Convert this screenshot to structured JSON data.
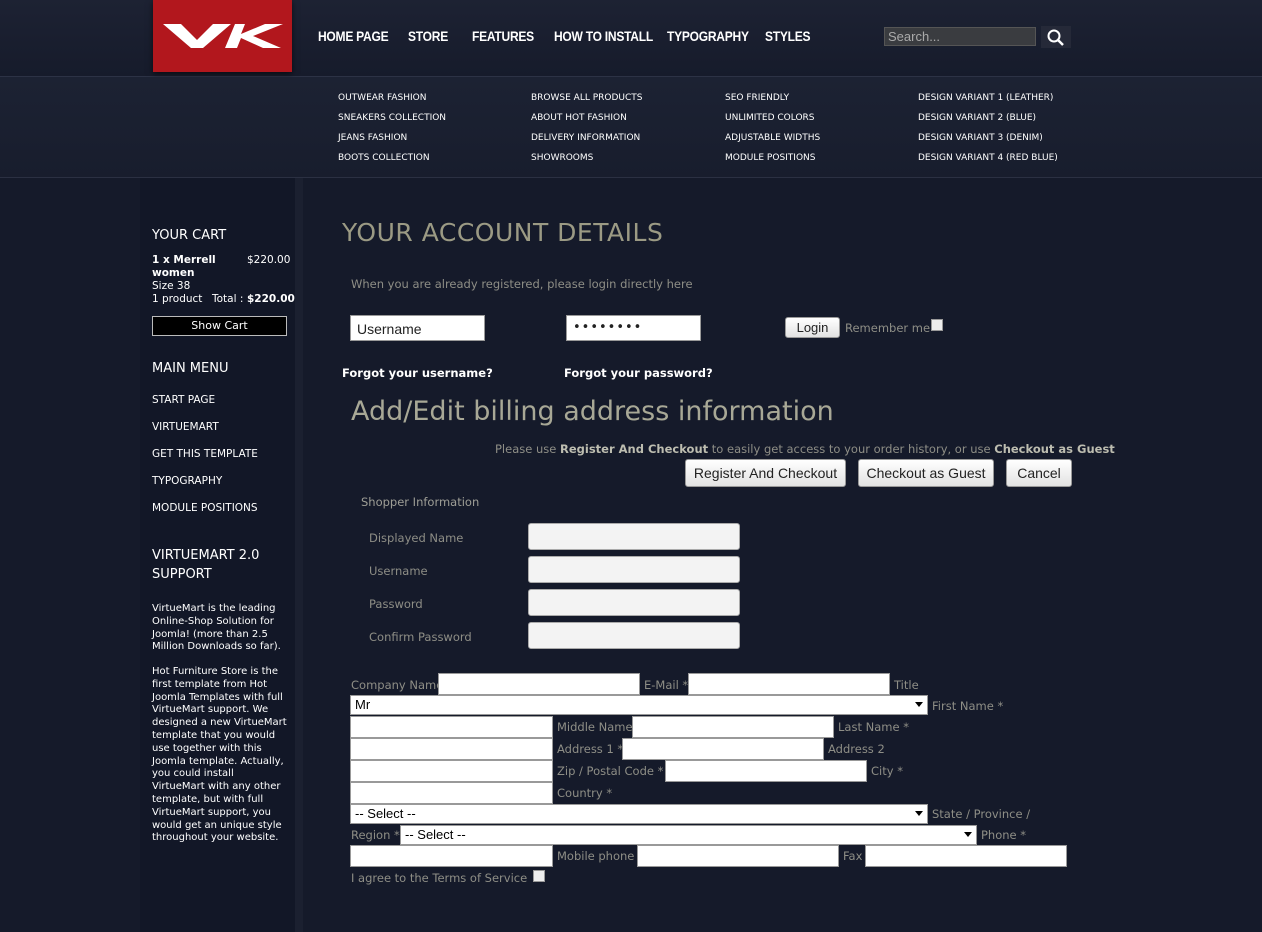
{
  "header": {
    "nav": [
      "HOME PAGE",
      "STORE",
      "FEATURES",
      "HOW TO INSTALL",
      "TYPOGRAPHY",
      "STYLES"
    ],
    "search_placeholder": "Search..."
  },
  "submenu": {
    "col1": [
      "OUTWEAR FASHION",
      "SNEAKERS COLLECTION",
      "JEANS FASHION",
      "BOOTS COLLECTION"
    ],
    "col2": [
      "BROWSE ALL PRODUCTS",
      "ABOUT HOT FASHION",
      "DELIVERY INFORMATION",
      "SHOWROOMS"
    ],
    "col3": [
      "SEO FRIENDLY",
      "UNLIMITED COLORS",
      "ADJUSTABLE WIDTHS",
      "MODULE POSITIONS"
    ],
    "col4": [
      "DESIGN VARIANT 1 (LEATHER)",
      "DESIGN VARIANT 2 (BLUE)",
      "DESIGN VARIANT 3 (DENIM)",
      "DESIGN VARIANT 4 (RED BLUE)"
    ]
  },
  "sidebar": {
    "cart_title": "YOUR CART",
    "cart_item": "1 x Merrell",
    "cart_item2": "women",
    "cart_price": "$220.00",
    "cart_size": "Size 38",
    "cart_count": "1 product",
    "cart_total_label": "Total : ",
    "cart_total": "$220.00",
    "show_cart": "Show Cart",
    "menu_title": "MAIN MENU",
    "menu_items": [
      "START PAGE",
      "VIRTUEMART",
      "GET THIS TEMPLATE",
      "TYPOGRAPHY",
      "MODULE POSITIONS"
    ],
    "support_title1": "VIRTUEMART 2.0",
    "support_title2": "SUPPORT",
    "support_p1": [
      "VirtueMart is the leading",
      "Online-Shop Solution for",
      "Joomla! (more than 2.5",
      "Million Downloads so far)."
    ],
    "support_p2": [
      "Hot Furniture Store is the",
      "first template from Hot",
      "Joomla Templates with full",
      "VirtueMart support. We",
      "designed a new VirtueMart",
      "template that you would",
      "use together with this",
      "Joomla template. Actually,",
      "you could install",
      "VirtueMart with any other",
      "template, but with full",
      "VirtueMart support, you",
      "would get an unique style",
      "throughout your website."
    ]
  },
  "main": {
    "title": "YOUR ACCOUNT DETAILS",
    "login_hint": "When you are already registered, please login directly here",
    "username_value": "Username",
    "password_value": "••••••••",
    "login_button": "Login",
    "remember_me": "Remember me",
    "forgot_username": "Forgot your username?",
    "forgot_password": "Forgot your password?",
    "billing_title": "Add/Edit billing address information",
    "checkout_hint_1": "Please use ",
    "checkout_hint_reg": "Register And Checkout",
    "checkout_hint_2": " to easily get access to your order history, or use ",
    "checkout_hint_guest": "Checkout as Guest",
    "btn_register": "Register And Checkout",
    "btn_guest": "Checkout as Guest",
    "btn_cancel": "Cancel",
    "shopper_info": "Shopper Information",
    "shopper_fields": [
      "Displayed Name",
      "Username",
      "Password",
      "Confirm Password"
    ],
    "labels": {
      "company": "Company Name",
      "email": "E-Mail *",
      "title": "Title",
      "first_name": "First Name *",
      "middle_name": "Middle Name",
      "last_name": "Last Name *",
      "address1": "Address 1 *",
      "address2": "Address 2",
      "zip": "Zip / Postal Code *",
      "city": "City *",
      "country": "Country *",
      "state1": "State / Province /",
      "state2": "Region *",
      "phone": "Phone *",
      "mobile": "Mobile phone",
      "fax": "Fax",
      "terms": "I agree to the Terms of Service"
    },
    "title_value": "Mr",
    "country_value": "-- Select --",
    "state_value": "-- Select --"
  }
}
